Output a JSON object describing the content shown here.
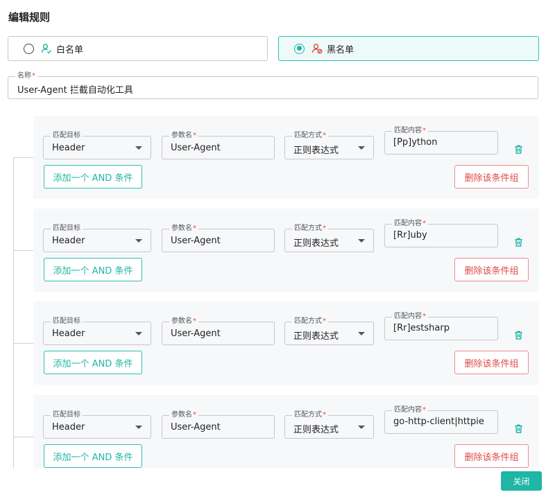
{
  "dialog": {
    "title": "编辑规则",
    "close_label": "关闭"
  },
  "list_type": {
    "options": [
      {
        "label": "白名单",
        "selected": false,
        "icon": "user-check-icon"
      },
      {
        "label": "黑名单",
        "selected": true,
        "icon": "user-block-icon"
      }
    ]
  },
  "name_field": {
    "label": "名称",
    "required_mark": "*",
    "value": "User-Agent 拦截自动化工具"
  },
  "labels": {
    "target": "匹配目标",
    "param": "参数名",
    "method": "匹配方式",
    "content": "匹配内容",
    "required_mark": "*",
    "add_and": "添加一个 AND 条件",
    "delete_group": "删除该条件组"
  },
  "groups": [
    {
      "target": "Header",
      "param": "User-Agent",
      "method": "正则表达式",
      "content": "[Pp]ython"
    },
    {
      "target": "Header",
      "param": "User-Agent",
      "method": "正则表达式",
      "content": "[Rr]uby"
    },
    {
      "target": "Header",
      "param": "User-Agent",
      "method": "正则表达式",
      "content": "[Rr]estsharp"
    },
    {
      "target": "Header",
      "param": "User-Agent",
      "method": "正则表达式",
      "content": "go-http-client|httpie"
    }
  ],
  "colors": {
    "accent": "#1fb6a5",
    "danger": "#e04a4a"
  }
}
